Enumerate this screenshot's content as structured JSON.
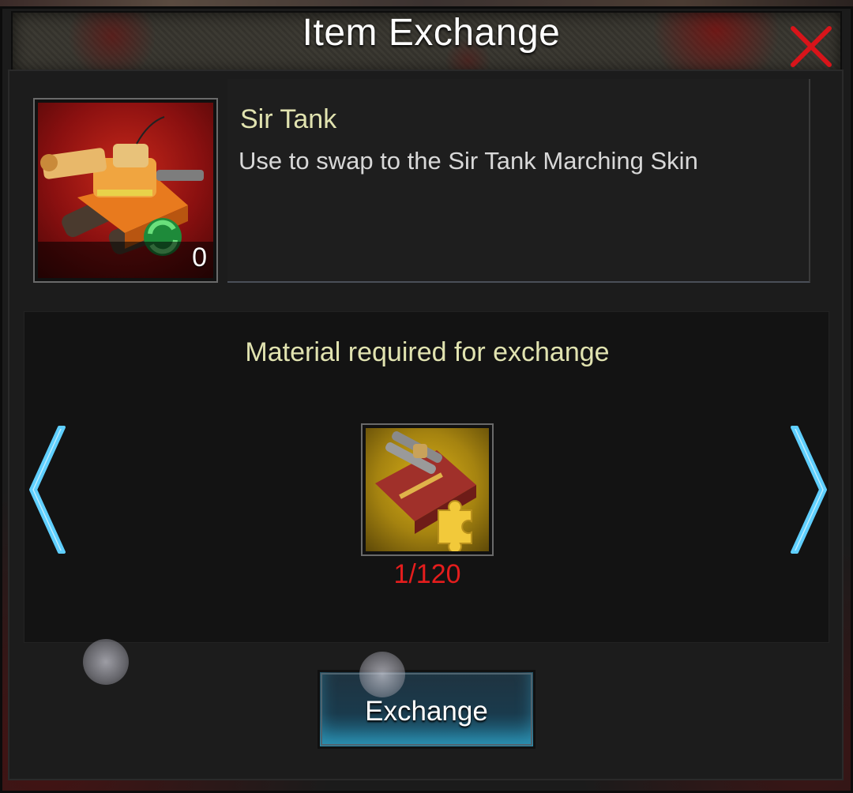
{
  "header": {
    "title": "Item Exchange",
    "close_icon": "close-x-icon",
    "close_color": "#d8141a"
  },
  "item": {
    "name": "Sir Tank",
    "description": "Use to swap to the Sir Tank Marching Skin",
    "count": "0",
    "icon": "sir-tank-skin-icon"
  },
  "material": {
    "title": "Material required for exchange",
    "progress": "1/120",
    "progress_color": "#e51d1d",
    "icon": "tank-puzzle-piece-icon",
    "prev_icon": "chevron-left-icon",
    "next_icon": "chevron-right-icon"
  },
  "actions": {
    "exchange_label": "Exchange"
  },
  "colors": {
    "accent_text": "#e1e3b0",
    "arrow": "#7fdcff"
  }
}
